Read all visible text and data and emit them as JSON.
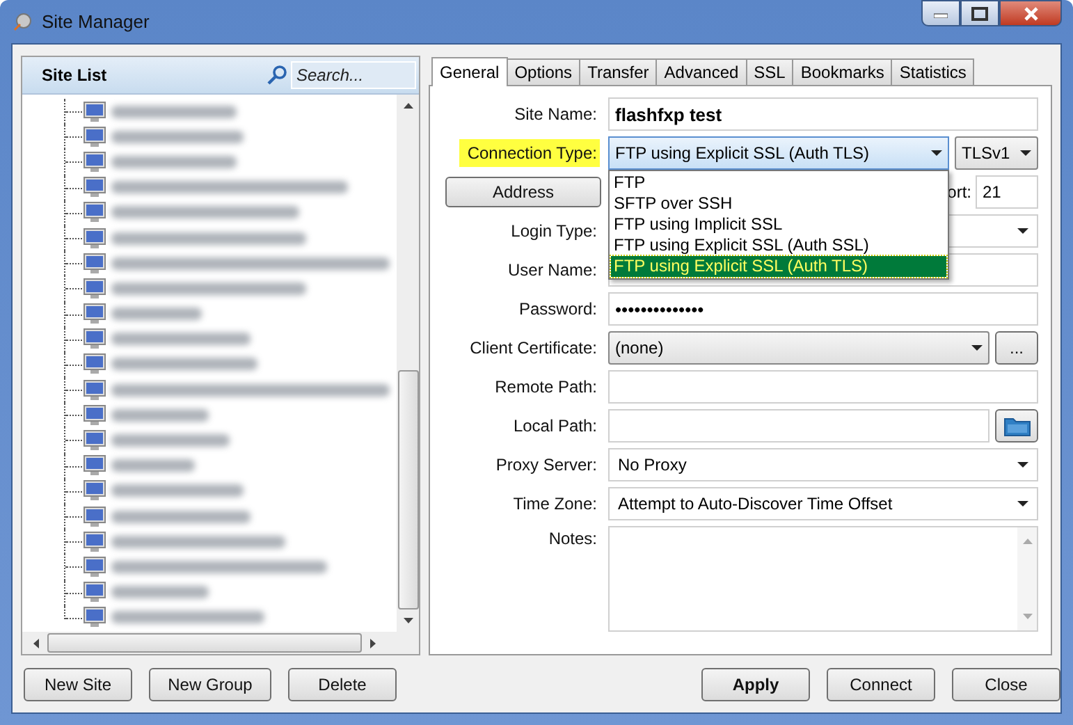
{
  "window": {
    "title": "Site Manager"
  },
  "site_list": {
    "title": "Site List",
    "search": {
      "placeholder": "Search..."
    },
    "items": [
      {
        "kind": "site"
      },
      {
        "kind": "site"
      },
      {
        "kind": "site"
      },
      {
        "kind": "site"
      },
      {
        "kind": "site"
      },
      {
        "kind": "site"
      },
      {
        "kind": "site"
      },
      {
        "kind": "site"
      },
      {
        "kind": "site"
      },
      {
        "kind": "site"
      },
      {
        "kind": "site"
      },
      {
        "kind": "site"
      },
      {
        "kind": "site"
      },
      {
        "kind": "site"
      },
      {
        "kind": "site"
      },
      {
        "kind": "site"
      },
      {
        "kind": "site"
      },
      {
        "kind": "site"
      },
      {
        "kind": "site"
      },
      {
        "kind": "site"
      },
      {
        "kind": "site"
      }
    ]
  },
  "tabs": [
    {
      "label": "General",
      "selected": true
    },
    {
      "label": "Options",
      "selected": false
    },
    {
      "label": "Transfer",
      "selected": false
    },
    {
      "label": "Advanced",
      "selected": false
    },
    {
      "label": "SSL",
      "selected": false
    },
    {
      "label": "Bookmarks",
      "selected": false
    },
    {
      "label": "Statistics",
      "selected": false
    }
  ],
  "fields": [
    {
      "kind": "text",
      "label": "Site Name:",
      "value": "flashfxp test",
      "emphasized": true
    },
    {
      "kind": "select",
      "label": "Connection Type:",
      "value": "FTP using Explicit SSL (Auth TLS)",
      "highlighted": true,
      "extra_select": "TLSv1",
      "expanded": true,
      "options": [
        {
          "label": "FTP",
          "selected": false
        },
        {
          "label": "SFTP over SSH",
          "selected": false
        },
        {
          "label": "FTP using Implicit SSL",
          "selected": false
        },
        {
          "label": "FTP using Explicit SSL (Auth SSL)",
          "selected": false
        },
        {
          "label": "FTP using Explicit SSL (Auth TLS)",
          "selected": true
        }
      ]
    },
    {
      "kind": "address",
      "button": "Address",
      "port_label": "ort:",
      "port": "21"
    },
    {
      "kind": "select",
      "label": "Login Type:"
    },
    {
      "kind": "text",
      "label": "User Name:"
    },
    {
      "kind": "password",
      "label": "Password:",
      "value": "••••••••••••••"
    },
    {
      "kind": "select",
      "label": "Client Certificate:",
      "value": "(none)",
      "button": "..."
    },
    {
      "kind": "text",
      "label": "Remote Path:"
    },
    {
      "kind": "text",
      "label": "Local Path:",
      "browse": true
    },
    {
      "kind": "select",
      "label": "Proxy Server:",
      "value": "No Proxy"
    },
    {
      "kind": "select",
      "label": "Time Zone:",
      "value": "Attempt to Auto-Discover Time Offset"
    },
    {
      "kind": "notes",
      "label": "Notes:"
    }
  ],
  "left_buttons": [
    "New Site",
    "New Group",
    "Delete"
  ],
  "right_buttons": [
    {
      "label": "Apply",
      "default": true
    },
    {
      "label": "Connect",
      "default": false
    },
    {
      "label": "Close",
      "default": false
    }
  ]
}
